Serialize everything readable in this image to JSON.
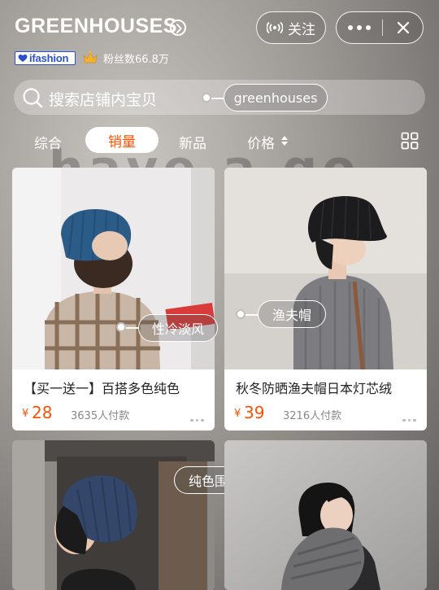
{
  "shop": {
    "name": "GREENHOUSES",
    "follow_label": "关注",
    "brand_badge": "ifashion",
    "fans": "粉丝数66.8万"
  },
  "search": {
    "placeholder": "搜索店铺内宝贝",
    "tag": "greenhouses"
  },
  "tabs": [
    "综合",
    "销量",
    "新品",
    "价格"
  ],
  "active_tab": "销量",
  "products": [
    {
      "title": "【买一送一】百搭多色纯色",
      "currency": "¥",
      "price": "28",
      "sold": "3635人付款",
      "tag": "性冷淡风"
    },
    {
      "title": "秋冬防晒渔夫帽日本灯芯绒",
      "currency": "¥",
      "price": "39",
      "sold": "3216人付款",
      "tag": "渔夫帽"
    },
    {
      "title": "",
      "tag": "纯色围巾"
    },
    {
      "title": ""
    }
  ],
  "colors": {
    "accent": "#ff5000",
    "brand_blue": "#2b4fd1"
  },
  "icons": [
    "chevron-right-icon",
    "broadcast-icon",
    "more-icon",
    "close-icon",
    "heart-icon",
    "crown-icon",
    "search-icon",
    "sort-icon",
    "grid-view-icon"
  ]
}
